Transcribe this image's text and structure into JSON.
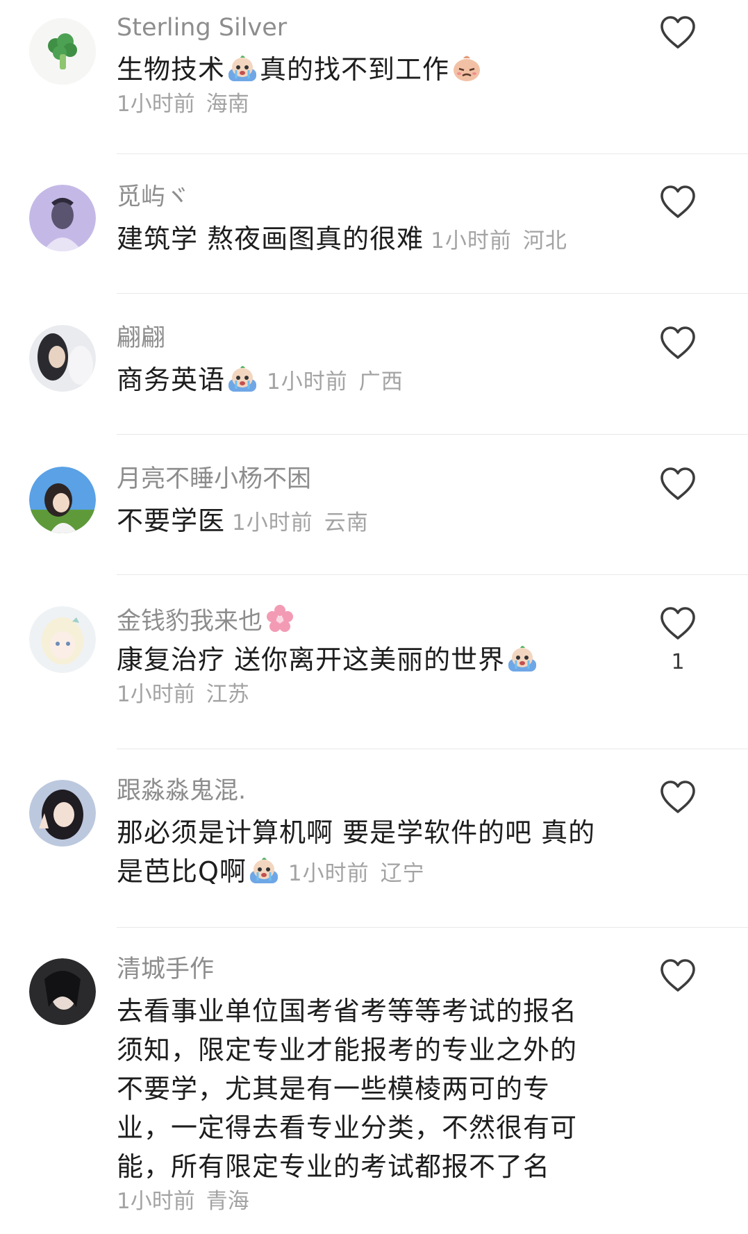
{
  "comments": [
    {
      "user": "Sterling Silver",
      "avatar": "broccoli-avatar",
      "text_parts": [
        "生物技术",
        "真的找不到工作"
      ],
      "emojis": [
        "crying-emoji",
        "sad-face-emoji"
      ],
      "time": "1小时前",
      "location": "海南",
      "likes": ""
    },
    {
      "user": "觅屿ヾ",
      "avatar": "purple-photo-avatar",
      "text": "建筑学  熬夜画图真的很难",
      "time": "1小时前",
      "location": "河北",
      "likes": ""
    },
    {
      "user": "翩翩",
      "avatar": "girl-photo-avatar",
      "text": "商务英语",
      "emojis": [
        "crying-emoji"
      ],
      "time": "1小时前",
      "location": "广西",
      "likes": ""
    },
    {
      "user": "月亮不睡小杨不困",
      "avatar": "sky-photo-avatar",
      "text": "不要学医",
      "time": "1小时前",
      "location": "云南",
      "likes": ""
    },
    {
      "user": "金钱豹我来也",
      "avatar": "anime-girl-avatar",
      "name_emoji": "cherry-blossom-emoji",
      "text": "康复治疗 送你离开这美丽的世界",
      "emojis": [
        "crying-emoji"
      ],
      "time": "1小时前",
      "location": "江苏",
      "likes": "1"
    },
    {
      "user": "跟淼淼鬼混.",
      "avatar": "peace-sign-girl-avatar",
      "text_lines": [
        "那必须是计算机啊 要是学软件的吧 真的",
        "是芭比Q啊"
      ],
      "emojis": [
        "crying-emoji"
      ],
      "time": "1小时前",
      "location": "辽宁",
      "likes": ""
    },
    {
      "user": "清城手作",
      "avatar": "dark-hair-girl-avatar",
      "text_lines": [
        "去看事业单位国考省考等等考试的报名",
        "须知，限定专业才能报考的专业之外的",
        "不要学，尤其是有一些模棱两可的专",
        "业，一定得去看专业分类，不然很有可",
        "能，所有限定专业的考试都报不了名"
      ],
      "time": "1小时前",
      "location": "青海",
      "likes": ""
    }
  ],
  "icons": {
    "like": "heart-outline-icon"
  },
  "colors": {
    "username": "#8d8d8d",
    "meta": "#a3a3a3",
    "text": "#1d1d1d"
  }
}
